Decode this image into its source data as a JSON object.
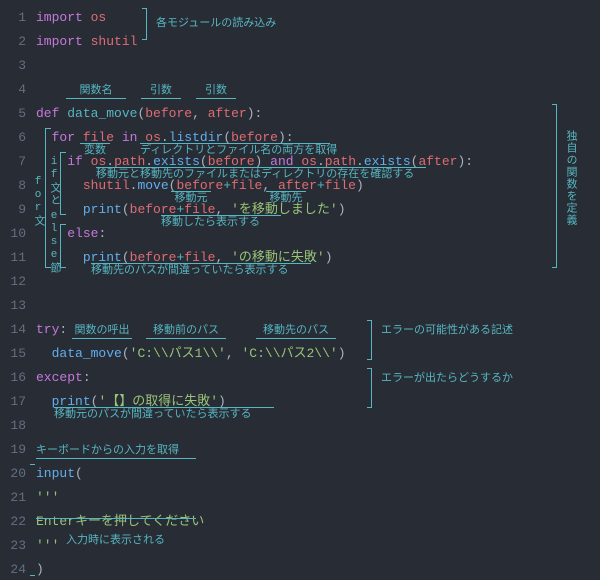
{
  "line_numbers": [
    "1",
    "2",
    "3",
    "4",
    "5",
    "6",
    "7",
    "8",
    "9",
    "10",
    "11",
    "12",
    "13",
    "14",
    "15",
    "16",
    "17",
    "18",
    "19",
    "20",
    "21",
    "22",
    "23",
    "24"
  ],
  "code": {
    "l1": {
      "import": "import",
      "os": "os"
    },
    "l2": {
      "import": "import",
      "shutil": "shutil"
    },
    "l5": {
      "def": "def",
      "name": "data_move",
      "lp": "(",
      "a1": "before",
      "c": ",",
      "sp": " ",
      "a2": "after",
      "rp": ")",
      "colon": ":"
    },
    "l6": {
      "for": "for",
      "var": "file",
      "in": "in",
      "mod": "os",
      "dot": ".",
      "fn": "listdir",
      "lp": "(",
      "arg": "before",
      "rp": ")",
      "colon": ":"
    },
    "l7": {
      "if": "if",
      "m1": "os",
      "d1": ".",
      "p1": "path",
      "d2": ".",
      "f1": "exists",
      "lp1": "(",
      "a1": "before",
      "rp1": ")",
      "and": "and",
      "m2": "os",
      "d3": ".",
      "p2": "path",
      "d4": ".",
      "f2": "exists",
      "lp2": "(",
      "a2": "after",
      "rp2": ")",
      "colon": ":"
    },
    "l8": {
      "m": "shutil",
      "d": ".",
      "fn": "move",
      "lp": "(",
      "a1": "before",
      "op1": "+",
      "a2": "file",
      "c": ",",
      "sp": " ",
      "a3": "after",
      "op2": "+",
      "a4": "file",
      "rp": ")"
    },
    "l9": {
      "fn": "print",
      "lp": "(",
      "a1": "before",
      "op": "+",
      "a2": "file",
      "c": ",",
      "sp": " ",
      "s": "'を移動しました'",
      "rp": ")"
    },
    "l10": {
      "else": "else",
      "colon": ":"
    },
    "l11": {
      "fn": "print",
      "lp": "(",
      "a1": "before",
      "op": "+",
      "a2": "file",
      "c": ",",
      "sp": " ",
      "s": "'の移動に失敗'",
      "rp": ")"
    },
    "l14": {
      "try": "try",
      "colon": ":"
    },
    "l15": {
      "fn": "data_move",
      "lp": "(",
      "s1": "'C:\\\\パス1\\\\'",
      "c": ",",
      "sp": " ",
      "s2": "'C:\\\\パス2\\\\'",
      "rp": ")"
    },
    "l16": {
      "except": "except",
      "colon": ":"
    },
    "l17": {
      "fn": "print",
      "lp": "(",
      "s": "'【】の取得に失敗'",
      "rp": ")"
    },
    "l20": {
      "fn": "input",
      "lp": "("
    },
    "l21": {
      "s": "'''"
    },
    "l22": {
      "s": "Enterキーを押してください"
    },
    "l23": {
      "s": "'''"
    },
    "l24": {
      "rp": ")"
    }
  },
  "annotations": {
    "imports": "各モジュールの読み込み",
    "fn_name": "関数名",
    "arg1": "引数",
    "arg2": "引数",
    "define_fn": "独自の関数を定義",
    "var": "変数",
    "listdir": "ディレクトリとファイル名の両方を取得",
    "exists": "移動元と移動先のファイルまたはディレクトリの存在を確認する",
    "for_block": "for文",
    "if_block": "if文と",
    "else_block": "else節",
    "move_src": "移動元",
    "move_dst": "移動先",
    "print_moved": "移動したら表示する",
    "print_fail": "移動先のパスが間違っていたら表示する",
    "call_fn": "関数の呼出",
    "path_before": "移動前のパス",
    "path_after": "移動先のパス",
    "try_note": "エラーの可能性がある記述",
    "except_note": "エラーが出たらどうするか",
    "except_fail": "移動元のパスが間違っていたら表示する",
    "input_header": "キーボードからの入力を取得",
    "prompt_disp": "入力時に表示される"
  }
}
